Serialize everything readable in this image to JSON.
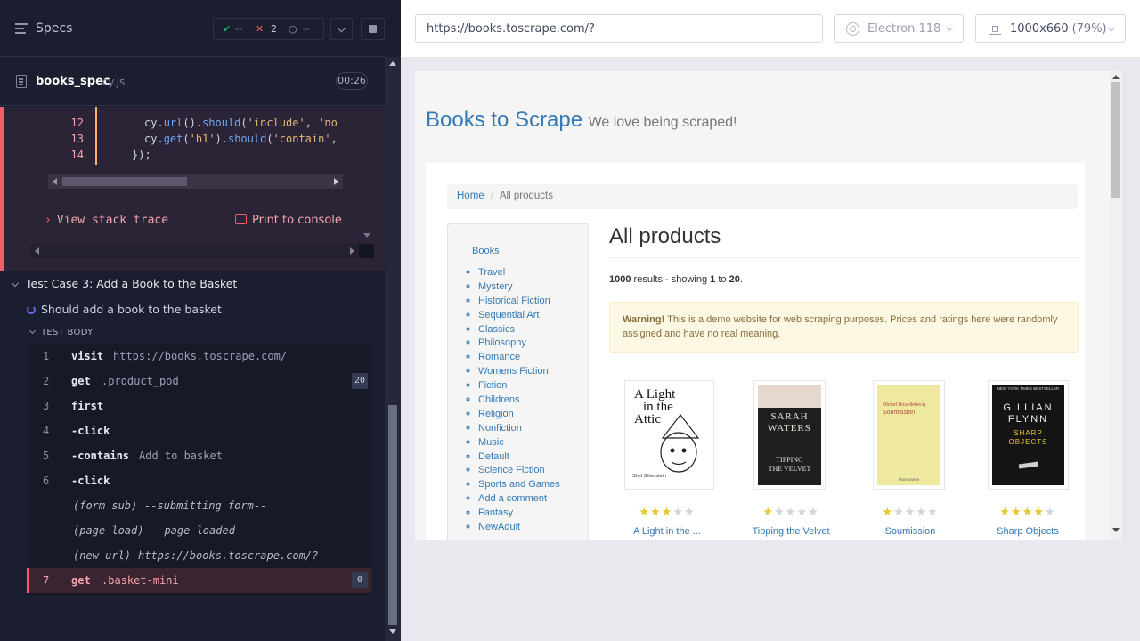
{
  "reporter": {
    "header": {
      "title": "Specs"
    },
    "stats": {
      "passed": "--",
      "failed": "2",
      "pending": "--"
    },
    "spec": {
      "name": "books_spec",
      "ext": ".cy.js",
      "duration": "00:26"
    },
    "error": {
      "code_lines": [
        {
          "num": "12",
          "code": "cy.url().should('include', 'no"
        },
        {
          "num": "13",
          "code": "cy.get('h1').should('contain',"
        },
        {
          "num": "14",
          "code": "});"
        }
      ],
      "view_stack_trace": "View stack trace",
      "print_to_console": "Print to console"
    },
    "test": {
      "title": "Test Case 3: Add a Book to the Basket",
      "should": "Should add a book to the basket",
      "body_label": "TEST BODY",
      "commands": [
        {
          "num": "1",
          "name": "visit",
          "msg": "https://books.toscrape.com/",
          "badge": ""
        },
        {
          "num": "2",
          "name": "get",
          "msg": ".product_pod",
          "badge": "20"
        },
        {
          "num": "3",
          "name": "first",
          "msg": "",
          "badge": ""
        },
        {
          "num": "4",
          "name": "-click",
          "msg": "",
          "badge": ""
        },
        {
          "num": "5",
          "name": "-contains",
          "msg": "Add to basket",
          "badge": ""
        },
        {
          "num": "6",
          "name": "-click",
          "msg": "",
          "badge": ""
        },
        {
          "num": "",
          "name": "(form sub)",
          "msg": "--submitting form--",
          "badge": ""
        },
        {
          "num": "",
          "name": "(page load)",
          "msg": "--page loaded--",
          "badge": ""
        },
        {
          "num": "",
          "name": "(new url)",
          "msg": "https://books.toscrape.com/?",
          "badge": ""
        },
        {
          "num": "7",
          "name": "get",
          "msg": ".basket-mini",
          "badge": "0"
        }
      ]
    }
  },
  "aut": {
    "url": "https://books.toscrape.com/?",
    "browser": "Electron 118",
    "viewport": {
      "size": "1000x660",
      "scale": "(79%)"
    },
    "site": {
      "brand": "Books to Scrape",
      "tagline": "We love being scraped!",
      "breadcrumb": {
        "home": "Home",
        "current": "All products"
      },
      "sidebar": {
        "heading": "Books",
        "categories": [
          "Travel",
          "Mystery",
          "Historical Fiction",
          "Sequential Art",
          "Classics",
          "Philosophy",
          "Romance",
          "Womens Fiction",
          "Fiction",
          "Childrens",
          "Religion",
          "Nonfiction",
          "Music",
          "Default",
          "Science Fiction",
          "Sports and Games",
          "Add a comment",
          "Fantasy",
          "NewAdult"
        ]
      },
      "heading": "All products",
      "results": {
        "total": "1000",
        "text1": "results - showing",
        "from": "1",
        "to_word": "to",
        "to": "20",
        "end": "."
      },
      "warning": {
        "label": "Warning!",
        "text": "This is a demo website for web scraping purposes. Prices and ratings here were randomly assigned and have no real meaning."
      },
      "products": [
        {
          "title": "A Light in the ...",
          "rating": 3,
          "cover": {
            "lines": [
              "A Light",
              "in the",
              "Attic"
            ],
            "author": "Shel Silverstein",
            "bg": "#ffffff"
          }
        },
        {
          "title": "Tipping the Velvet",
          "rating": 1,
          "cover": {
            "lines": [
              "SARAH",
              "WATERS",
              "TIPPING",
              "THE VELVET"
            ],
            "bg": "#1f1f1f"
          }
        },
        {
          "title": "Soumission",
          "rating": 1,
          "cover": {
            "lines": [
              "Michel Houellebecq",
              "Soumission",
              "Flammarion"
            ],
            "bg": "#efe9a0"
          }
        },
        {
          "title": "Sharp Objects",
          "rating": 4,
          "cover": {
            "lines": [
              "GILLIAN",
              "FLYNN",
              "SHARP",
              "OBJECTS"
            ],
            "author": "NEW YORK TIMES BESTSELLER",
            "bg": "#141414"
          }
        }
      ]
    }
  },
  "colors": {
    "accent_fail": "#f25e68",
    "link": "#337ab7",
    "star_on": "#e6c72e"
  }
}
